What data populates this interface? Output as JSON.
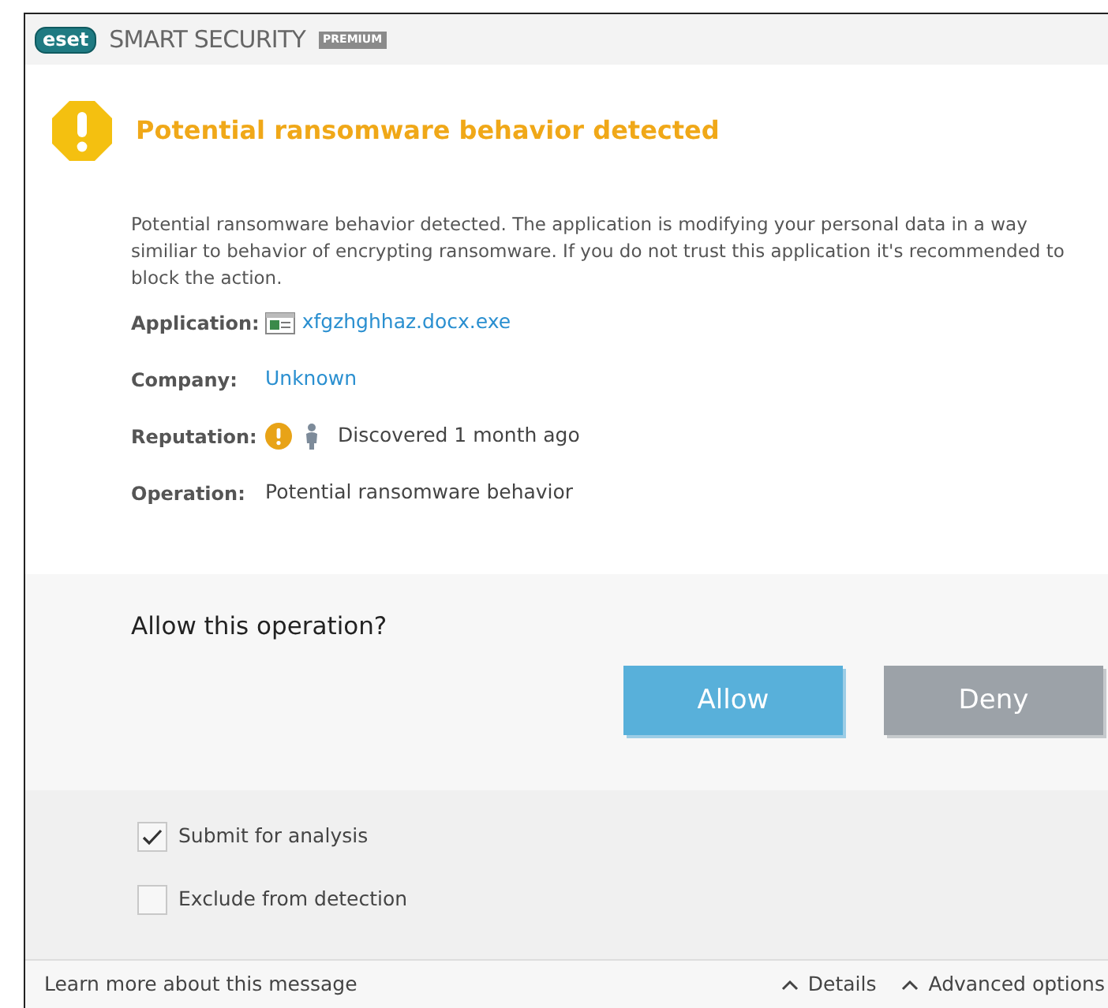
{
  "header": {
    "logo": "eset",
    "product": "SMART SECURITY",
    "edition": "PREMIUM"
  },
  "alert": {
    "title": "Potential ransomware behavior detected",
    "description": "Potential ransomware behavior detected. The application is modifying your personal data in a way similiar to behavior of encrypting ransomware. If you do not trust this application it's recommended to block the action."
  },
  "fields": [
    {
      "kind": "file",
      "label": "Application:",
      "value": "xfgzhghhaz.docx.exe"
    },
    {
      "kind": "link",
      "label": "Company:",
      "value": "Unknown"
    },
    {
      "kind": "reputation",
      "label": "Reputation:",
      "value": "Discovered 1 month ago"
    },
    {
      "kind": "text",
      "label": "Operation:",
      "value": "Potential ransomware behavior"
    }
  ],
  "question": "Allow this operation?",
  "buttons": [
    {
      "kind": "primary",
      "label": "Allow"
    },
    {
      "kind": "secondary",
      "label": "Deny"
    }
  ],
  "options": [
    {
      "label": "Submit for analysis",
      "checked": true
    },
    {
      "label": "Exclude from detection",
      "checked": false
    }
  ],
  "footer": {
    "learn_more": "Learn more about this message",
    "links": [
      "Details",
      "Advanced options"
    ]
  }
}
